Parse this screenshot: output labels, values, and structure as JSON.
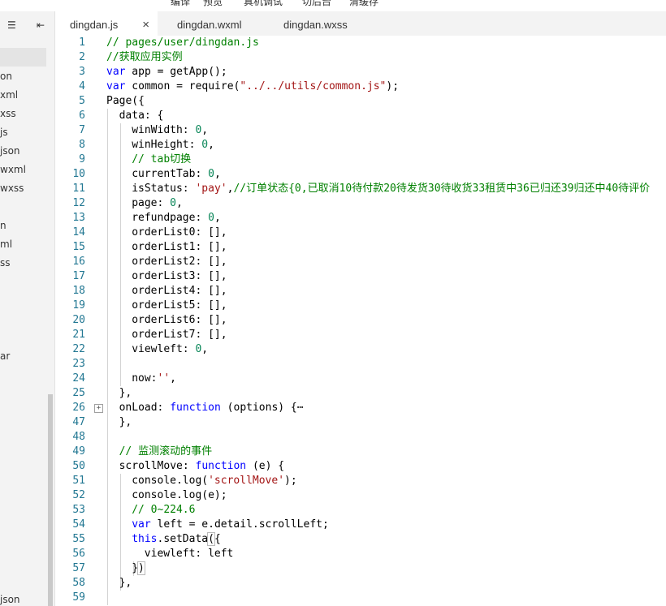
{
  "toolbar": {
    "labels": [
      "编译",
      "预览",
      "真机调试",
      "切后台",
      "清缓存"
    ]
  },
  "sidebar": {
    "header_icons": [
      "collapse-lines-icon",
      "split-icon"
    ],
    "items": [
      {
        "label": "",
        "selected": true
      },
      {
        "label": "on"
      },
      {
        "label": "xml"
      },
      {
        "label": "xss"
      },
      {
        "label": "js"
      },
      {
        "label": "json"
      },
      {
        "label": "wxml"
      },
      {
        "label": "wxss"
      },
      {
        "label": ""
      },
      {
        "label": "n"
      },
      {
        "label": "ml"
      },
      {
        "label": "ss"
      },
      {
        "label": ""
      },
      {
        "label": ""
      },
      {
        "label": ""
      },
      {
        "label": "ar"
      },
      {
        "label": "json"
      }
    ]
  },
  "tabs": [
    {
      "label": "dingdan.js",
      "active": true,
      "close": "×"
    },
    {
      "label": "dingdan.wxml",
      "active": false
    },
    {
      "label": "dingdan.wxss",
      "active": false
    }
  ],
  "colors": {
    "comment": "#008000",
    "keyword": "#0000ff",
    "string": "#a31515",
    "number": "#098658",
    "line_number": "#237893"
  },
  "editor": {
    "lines": [
      {
        "n": "1",
        "indent": 0,
        "tokens": [
          [
            "cm",
            "// pages/user/dingdan.js"
          ]
        ]
      },
      {
        "n": "2",
        "indent": 0,
        "tokens": [
          [
            "cm",
            "//获取应用实例"
          ]
        ]
      },
      {
        "n": "3",
        "indent": 0,
        "tokens": [
          [
            "kw",
            "var"
          ],
          [
            "",
            " app = getApp();"
          ]
        ]
      },
      {
        "n": "4",
        "indent": 0,
        "tokens": [
          [
            "kw",
            "var"
          ],
          [
            "",
            " common = require("
          ],
          [
            "st",
            "\"../../utils/common.js\""
          ],
          [
            "",
            ");"
          ]
        ]
      },
      {
        "n": "5",
        "indent": 0,
        "tokens": [
          [
            "",
            "Page({"
          ]
        ]
      },
      {
        "n": "6",
        "indent": 1,
        "tokens": [
          [
            "",
            "data: {"
          ]
        ]
      },
      {
        "n": "7",
        "indent": 2,
        "tokens": [
          [
            "",
            "winWidth: "
          ],
          [
            "nm",
            "0"
          ],
          [
            "",
            ","
          ]
        ]
      },
      {
        "n": "8",
        "indent": 2,
        "tokens": [
          [
            "",
            "winHeight: "
          ],
          [
            "nm",
            "0"
          ],
          [
            "",
            ","
          ]
        ]
      },
      {
        "n": "9",
        "indent": 2,
        "tokens": [
          [
            "cm",
            "// tab切换"
          ]
        ]
      },
      {
        "n": "10",
        "indent": 2,
        "tokens": [
          [
            "",
            "currentTab: "
          ],
          [
            "nm",
            "0"
          ],
          [
            "",
            ","
          ]
        ]
      },
      {
        "n": "11",
        "indent": 2,
        "tokens": [
          [
            "",
            "isStatus: "
          ],
          [
            "st",
            "'pay'"
          ],
          [
            "",
            ","
          ],
          [
            "cm",
            "//订单状态{0,已取消10待付款20待发货30待收货33租赁中36已归还39归还中40待评价"
          ]
        ]
      },
      {
        "n": "12",
        "indent": 2,
        "tokens": [
          [
            "",
            "page: "
          ],
          [
            "nm",
            "0"
          ],
          [
            "",
            ","
          ]
        ]
      },
      {
        "n": "13",
        "indent": 2,
        "tokens": [
          [
            "",
            "refundpage: "
          ],
          [
            "nm",
            "0"
          ],
          [
            "",
            ","
          ]
        ]
      },
      {
        "n": "14",
        "indent": 2,
        "tokens": [
          [
            "",
            "orderList0: [],"
          ]
        ]
      },
      {
        "n": "15",
        "indent": 2,
        "tokens": [
          [
            "",
            "orderList1: [],"
          ]
        ]
      },
      {
        "n": "16",
        "indent": 2,
        "tokens": [
          [
            "",
            "orderList2: [],"
          ]
        ]
      },
      {
        "n": "17",
        "indent": 2,
        "tokens": [
          [
            "",
            "orderList3: [],"
          ]
        ]
      },
      {
        "n": "18",
        "indent": 2,
        "tokens": [
          [
            "",
            "orderList4: [],"
          ]
        ]
      },
      {
        "n": "19",
        "indent": 2,
        "tokens": [
          [
            "",
            "orderList5: [],"
          ]
        ]
      },
      {
        "n": "20",
        "indent": 2,
        "tokens": [
          [
            "",
            "orderList6: [],"
          ]
        ]
      },
      {
        "n": "21",
        "indent": 2,
        "tokens": [
          [
            "",
            "orderList7: [],"
          ]
        ]
      },
      {
        "n": "22",
        "indent": 2,
        "tokens": [
          [
            "",
            "viewleft: "
          ],
          [
            "nm",
            "0"
          ],
          [
            "",
            ","
          ]
        ]
      },
      {
        "n": "23",
        "indent": 2,
        "tokens": []
      },
      {
        "n": "24",
        "indent": 2,
        "tokens": [
          [
            "",
            "now:"
          ],
          [
            "st",
            "''"
          ],
          [
            "",
            ","
          ]
        ]
      },
      {
        "n": "25",
        "indent": 1,
        "tokens": [
          [
            "",
            "},"
          ]
        ]
      },
      {
        "n": "26",
        "indent": 1,
        "fold": "+",
        "tokens": [
          [
            "",
            "onLoad: "
          ],
          [
            "kw",
            "function"
          ],
          [
            "",
            " (options) {⋯"
          ]
        ]
      },
      {
        "n": "47",
        "indent": 1,
        "tokens": [
          [
            "",
            "},"
          ]
        ]
      },
      {
        "n": "48",
        "indent": 1,
        "tokens": []
      },
      {
        "n": "49",
        "indent": 1,
        "tokens": [
          [
            "cm",
            "// 监测滚动的事件"
          ]
        ]
      },
      {
        "n": "50",
        "indent": 1,
        "tokens": [
          [
            "",
            "scrollMove: "
          ],
          [
            "kw",
            "function"
          ],
          [
            "",
            " (e) {"
          ]
        ]
      },
      {
        "n": "51",
        "indent": 2,
        "tokens": [
          [
            "",
            "console.log("
          ],
          [
            "st",
            "'scrollMove'"
          ],
          [
            "",
            ");"
          ]
        ]
      },
      {
        "n": "52",
        "indent": 2,
        "tokens": [
          [
            "",
            "console.log(e);"
          ]
        ]
      },
      {
        "n": "53",
        "indent": 2,
        "tokens": [
          [
            "cm",
            "// 0~224.6"
          ]
        ]
      },
      {
        "n": "54",
        "indent": 2,
        "tokens": [
          [
            "kw",
            "var"
          ],
          [
            "",
            " left = e.detail.scrollLeft;"
          ]
        ]
      },
      {
        "n": "55",
        "indent": 2,
        "tokens": [
          [
            "kw",
            "this"
          ],
          [
            "",
            ".setData"
          ],
          [
            "bm",
            "("
          ],
          [
            "",
            "{"
          ]
        ]
      },
      {
        "n": "56",
        "indent": 3,
        "tokens": [
          [
            "",
            "viewleft: left"
          ]
        ]
      },
      {
        "n": "57",
        "indent": 2,
        "tokens": [
          [
            "",
            "}"
          ],
          [
            "bm",
            ")"
          ]
        ]
      },
      {
        "n": "58",
        "indent": 1,
        "tokens": [
          [
            "",
            "},"
          ]
        ]
      },
      {
        "n": "59",
        "indent": 1,
        "tokens": []
      }
    ]
  }
}
